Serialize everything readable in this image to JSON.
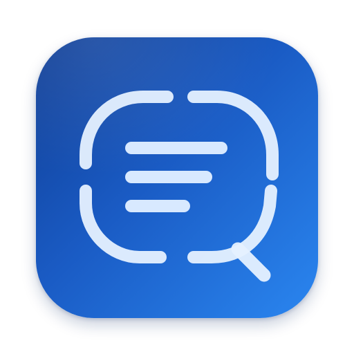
{
  "app_icon": {
    "name": "document-search-app-icon",
    "colors": {
      "background_dark": "#0f3d94",
      "background_mid": "#1a5bc4",
      "background_light": "#2a86f0",
      "glyph": "#e6f1ff"
    },
    "icon_names": [
      "speech-bubble-icon",
      "text-lines-icon",
      "magnifier-handle-icon"
    ]
  }
}
